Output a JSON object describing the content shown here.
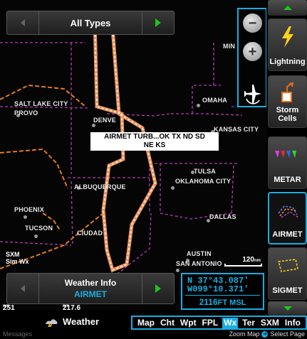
{
  "type_selector": {
    "label": "All Types"
  },
  "map": {
    "cities": [
      {
        "id": "salt-lake-city",
        "label": "SALT LAKE CITY"
      },
      {
        "id": "provo",
        "label": "PROVO"
      },
      {
        "id": "denver",
        "label": "DENVE"
      },
      {
        "id": "omaha",
        "label": "OMAHA"
      },
      {
        "id": "kansas-city",
        "label": "KANSAS CITY"
      },
      {
        "id": "tulsa",
        "label": "TULSA"
      },
      {
        "id": "oklahoma-city",
        "label": "OKLAHOMA CITY"
      },
      {
        "id": "albuquerque",
        "label": "ALBUQUERQUE"
      },
      {
        "id": "phoenix",
        "label": "PHOENIX"
      },
      {
        "id": "tucson",
        "label": "TUCSON"
      },
      {
        "id": "ciudad",
        "label": "CIUDAD"
      },
      {
        "id": "dallas",
        "label": "DALLAS"
      },
      {
        "id": "austin",
        "label": "AUSTIN"
      },
      {
        "id": "san-antonio",
        "label": "SAN ANTONIO"
      },
      {
        "id": "minneapolis",
        "label": "MIN"
      }
    ],
    "callout_line1": "AIRMET TURB...OK TX ND SD",
    "callout_line2": "NE KS",
    "scale_value": "120",
    "scale_unit": "nm",
    "sxm_label_line1": "SXM",
    "sxm_label_line2": "Sim Wx"
  },
  "weather_info": {
    "title": "Weather Info",
    "value": "AIRMET"
  },
  "position": {
    "lat": "N  37°43.087'",
    "lon": "W099°10.371'",
    "altitude": "2116",
    "altitude_unit": "FT MSL"
  },
  "distances": {
    "left": "251",
    "left_unit": "nm",
    "right": "217.6",
    "right_unit": "nm"
  },
  "softkeys": [
    {
      "id": "lightning",
      "label": "Lightning"
    },
    {
      "id": "storm-cells",
      "label_line1": "Storm",
      "label_line2": "Cells"
    },
    {
      "id": "metar",
      "label": "METAR"
    },
    {
      "id": "airmet",
      "label": "AIRMET"
    },
    {
      "id": "sigmet",
      "label": "SIGMET"
    }
  ],
  "page": {
    "name": "Weather"
  },
  "tabs": [
    "Map",
    "Cht",
    "Wpt",
    "FPL",
    "Wx",
    "Ter",
    "SXM",
    "Info"
  ],
  "active_tab": "Wx",
  "footer": {
    "messages": "Messages",
    "hint_prefix": "Zoom Map",
    "hint_suffix": "Select Page"
  },
  "colors": {
    "accent": "#19aee0",
    "green": "#19c819",
    "airmet_outline": "#e8925a",
    "state_border": "#c23ac2",
    "artcc_boundary": "#e07b1e"
  }
}
